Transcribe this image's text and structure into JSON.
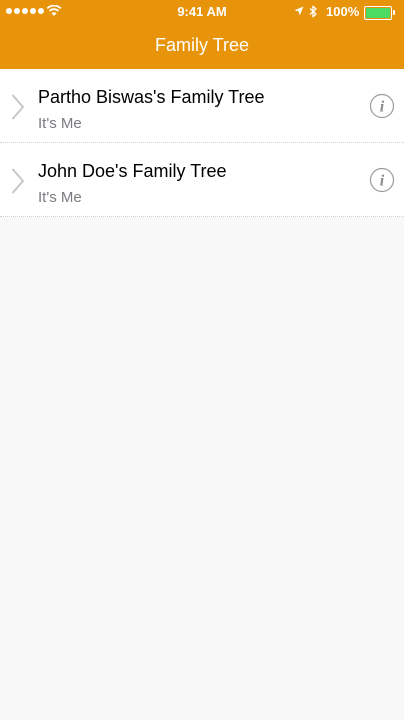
{
  "status_bar": {
    "time": "9:41 AM",
    "battery": "100%",
    "signal_icon": "signal-dots-icon",
    "wifi_icon": "wifi-icon",
    "location_icon": "location-arrow-icon",
    "bluetooth_icon": "bluetooth-icon",
    "battery_icon": "battery-icon",
    "battery_color": "#4cd964"
  },
  "nav": {
    "title": "Family Tree",
    "color": "#e8940a"
  },
  "list": {
    "items": [
      {
        "title": "Partho Biswas's Family Tree",
        "subtitle": "It's Me",
        "left_icon": "chevron-right-icon",
        "right_icon": "info-icon"
      },
      {
        "title": "John Doe's Family Tree",
        "subtitle": "It's Me",
        "left_icon": "chevron-right-icon",
        "right_icon": "info-icon"
      }
    ]
  }
}
